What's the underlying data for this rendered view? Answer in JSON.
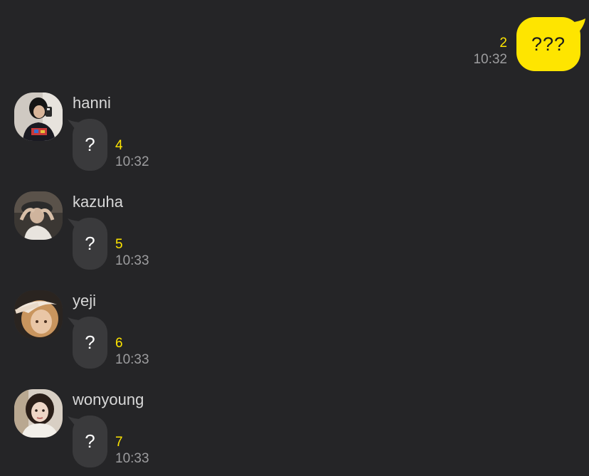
{
  "colors": {
    "background": "#252527",
    "outgoing_bubble": "#FEE500",
    "incoming_bubble": "#3a3a3c",
    "unread_count": "#FEE500",
    "timestamp": "#9d9d9f"
  },
  "outgoing": {
    "text": "???",
    "unread": "2",
    "time": "10:32"
  },
  "incoming": [
    {
      "sender": "hanni",
      "text": "?",
      "unread": "4",
      "time": "10:32"
    },
    {
      "sender": "kazuha",
      "text": "?",
      "unread": "5",
      "time": "10:33"
    },
    {
      "sender": "yeji",
      "text": "?",
      "unread": "6",
      "time": "10:33"
    },
    {
      "sender": "wonyoung",
      "text": "?",
      "unread": "7",
      "time": "10:33"
    }
  ]
}
